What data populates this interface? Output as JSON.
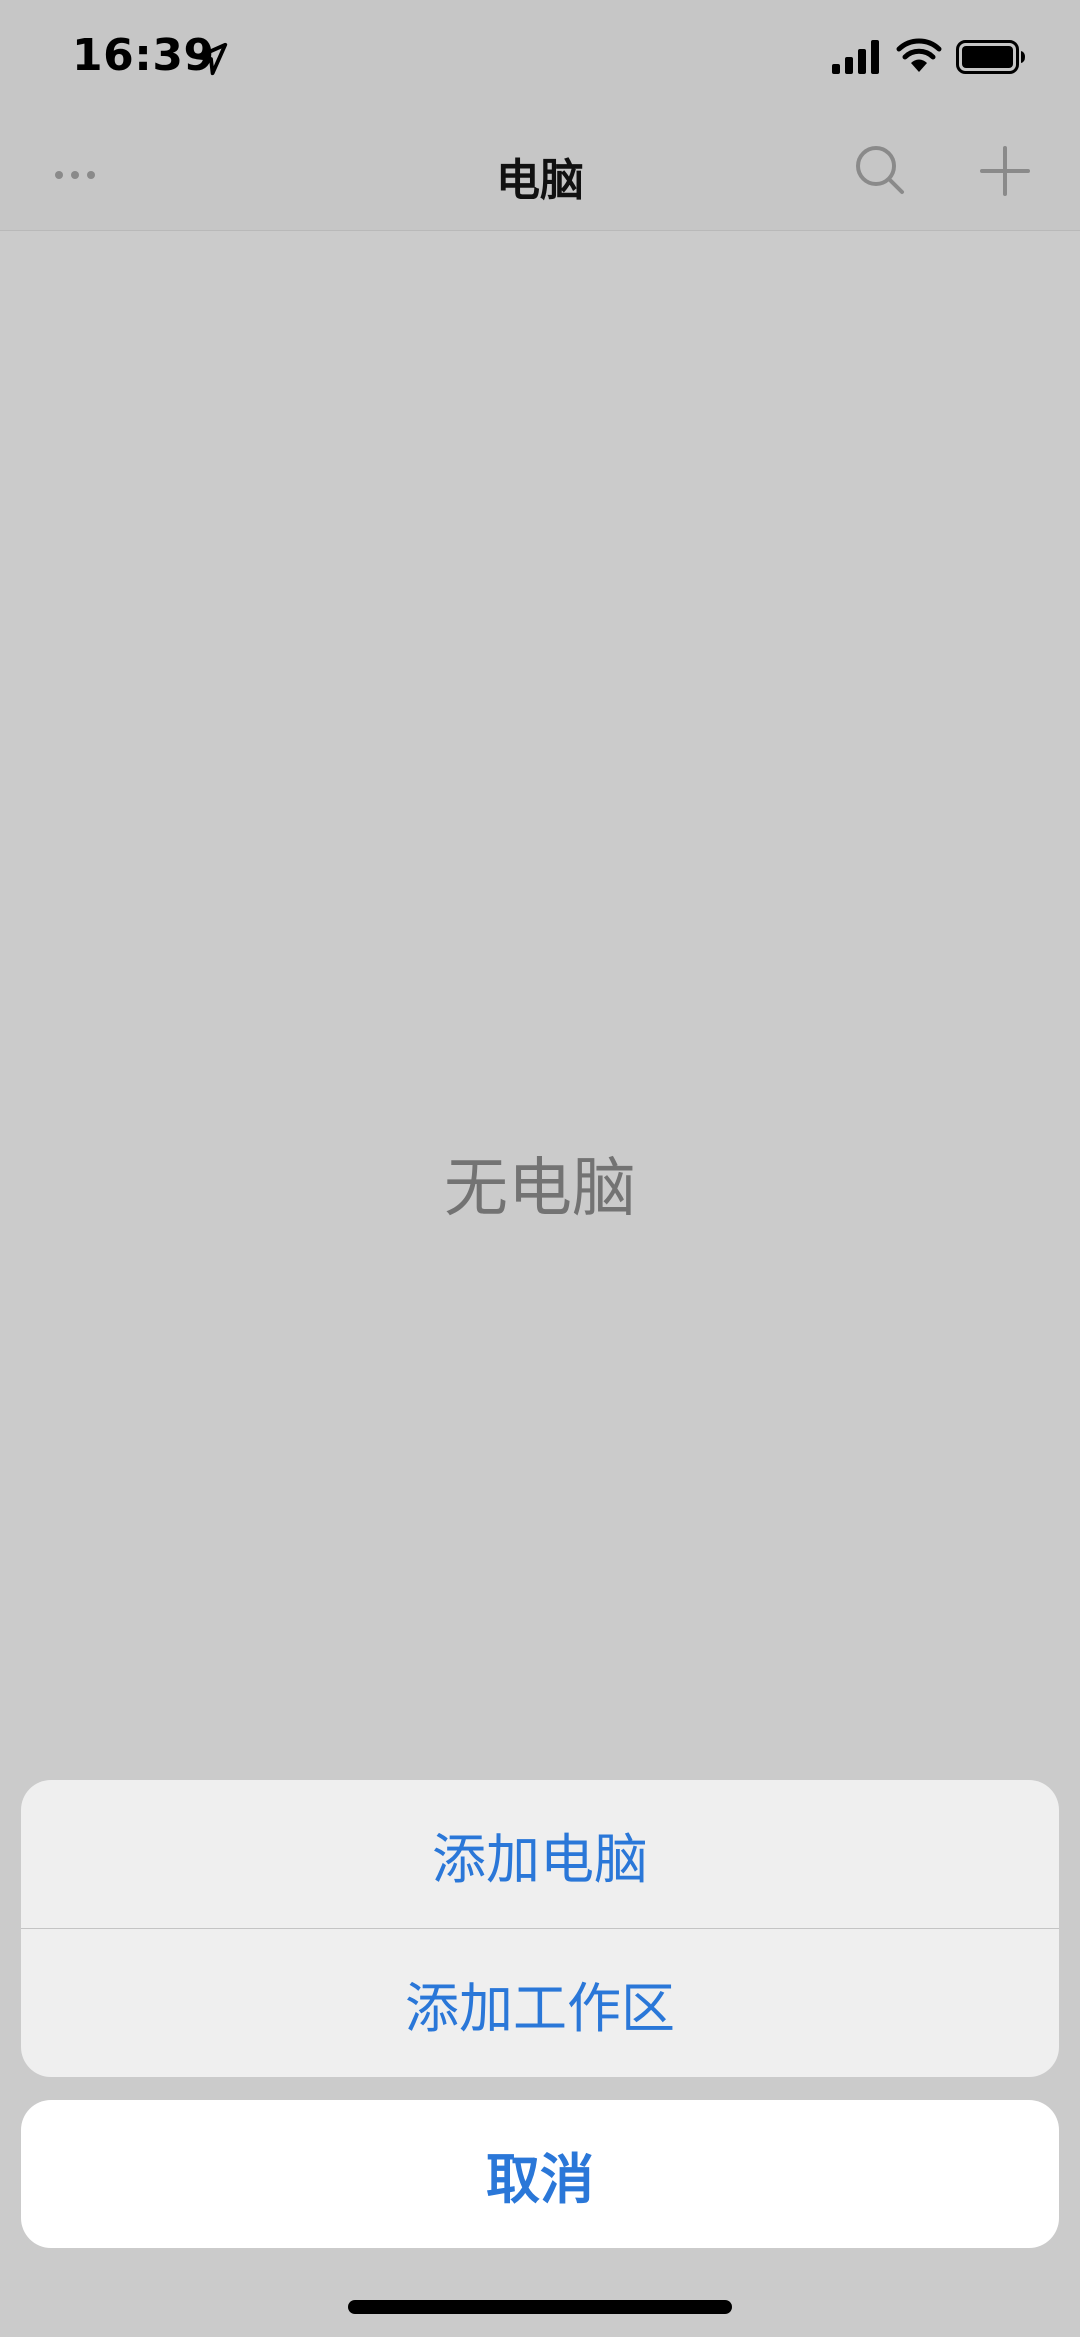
{
  "status_bar": {
    "time": "16:39",
    "icons": [
      "location-arrow-icon",
      "cellular-signal-icon",
      "wifi-icon",
      "battery-icon"
    ]
  },
  "nav": {
    "title": "电脑",
    "left_icon": "more-icon",
    "right_icons": [
      "search-icon",
      "add-icon"
    ]
  },
  "main": {
    "empty_message": "无电脑"
  },
  "action_sheet": {
    "options": [
      {
        "label": "添加电脑"
      },
      {
        "label": "添加工作区"
      }
    ],
    "cancel_label": "取消"
  },
  "colors": {
    "accent": "#2a77d8",
    "background": "#cbcbcb",
    "bar_background": "#c6c6c6",
    "sheet_group_background": "#efefef",
    "cancel_background": "#ffffff",
    "empty_text": "#737373"
  }
}
